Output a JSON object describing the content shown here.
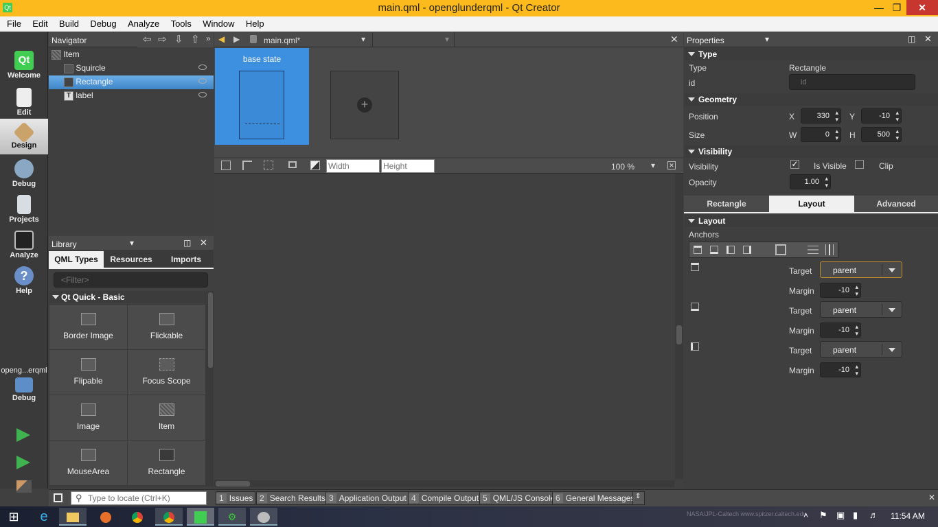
{
  "window": {
    "title": "main.qml - openglunderqml - Qt Creator",
    "app_icon": "Qt"
  },
  "menu": [
    "File",
    "Edit",
    "Build",
    "Debug",
    "Analyze",
    "Tools",
    "Window",
    "Help"
  ],
  "modes": [
    {
      "label": "Welcome",
      "icon": "qt-logo-icon"
    },
    {
      "label": "Edit",
      "icon": "document-icon"
    },
    {
      "label": "Design",
      "icon": "pencil-ruler-icon",
      "active": true
    },
    {
      "label": "Debug",
      "icon": "bug-icon"
    },
    {
      "label": "Projects",
      "icon": "wrench-icon"
    },
    {
      "label": "Analyze",
      "icon": "analyze-icon"
    },
    {
      "label": "Help",
      "icon": "help-icon"
    }
  ],
  "kit": {
    "project": "openg...erqml",
    "config": "Debug"
  },
  "navigator": {
    "title": "Navigator",
    "items": [
      {
        "label": "Item"
      },
      {
        "label": "Squircle"
      },
      {
        "label": "Rectangle",
        "selected": true
      },
      {
        "label": "label"
      }
    ]
  },
  "editor": {
    "file_tab": "main.qml*",
    "state_label": "base state",
    "width_placeholder": "Width",
    "height_placeholder": "Height",
    "zoom": "100 %"
  },
  "library": {
    "title": "Library",
    "tabs": [
      "QML Types",
      "Resources",
      "Imports"
    ],
    "filter_placeholder": "<Filter>",
    "section": "Qt Quick - Basic",
    "items": [
      "Border Image",
      "Flickable",
      "Flipable",
      "Focus Scope",
      "Image",
      "Item",
      "MouseArea",
      "Rectangle"
    ]
  },
  "properties": {
    "title": "Properties",
    "type_section": "Type",
    "type_label": "Type",
    "type_value": "Rectangle",
    "id_label": "id",
    "id_placeholder": "id",
    "geometry_section": "Geometry",
    "position_label": "Position",
    "x_label": "X",
    "x": "330",
    "y_label": "Y",
    "y": "-10",
    "size_label": "Size",
    "w_label": "W",
    "w": "0",
    "h_label": "H",
    "h": "500",
    "visibility_section": "Visibility",
    "visibility_label": "Visibility",
    "is_visible": "Is Visible",
    "clip": "Clip",
    "opacity_label": "Opacity",
    "opacity": "1.00",
    "tabs": [
      "Rectangle",
      "Layout",
      "Advanced"
    ],
    "layout_section": "Layout",
    "anchors_label": "Anchors",
    "anchors": [
      {
        "target_label": "Target",
        "target": "parent",
        "margin_label": "Margin",
        "margin": "-10"
      },
      {
        "target_label": "Target",
        "target": "parent",
        "margin_label": "Margin",
        "margin": "-10"
      },
      {
        "target_label": "Target",
        "target": "parent",
        "margin_label": "Margin",
        "margin": "-10"
      }
    ]
  },
  "output": {
    "locate_placeholder": "Type to locate (Ctrl+K)",
    "tabs": [
      {
        "num": "1",
        "label": "Issues"
      },
      {
        "num": "2",
        "label": "Search Results"
      },
      {
        "num": "3",
        "label": "Application Output"
      },
      {
        "num": "4",
        "label": "Compile Output"
      },
      {
        "num": "5",
        "label": "QML/JS Console"
      },
      {
        "num": "6",
        "label": "General Messages"
      }
    ]
  },
  "taskbar": {
    "clock": "11:54 AM",
    "wallpaper_credit": "NASA/JPL-Caltech   www.spitzer.caltech.edu"
  }
}
